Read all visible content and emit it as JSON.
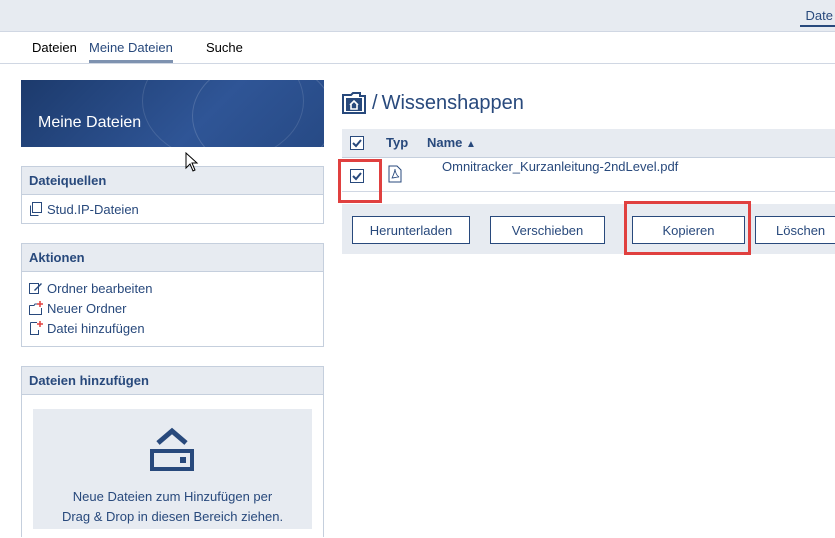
{
  "topbar": {
    "link_label": "Date"
  },
  "nav": {
    "tabs": [
      "Dateien",
      "Meine Dateien",
      "Suche"
    ]
  },
  "sidebar": {
    "header_title": "Meine Dateien",
    "sources": {
      "title": "Dateiquellen",
      "items": [
        "Stud.IP-Dateien"
      ]
    },
    "actions": {
      "title": "Aktionen",
      "items": [
        "Ordner bearbeiten",
        "Neuer Ordner",
        "Datei hinzufügen"
      ]
    },
    "upload": {
      "title": "Dateien hinzufügen",
      "drop_text_1": "Neue Dateien zum Hinzufügen per",
      "drop_text_2": "Drag & Drop in diesen Bereich ziehen."
    }
  },
  "main": {
    "breadcrumb_sep": "/",
    "folder_name": "Wissenshappen",
    "table": {
      "col_type": "Typ",
      "col_name": "Name",
      "sort_indicator": "▲",
      "rows": [
        {
          "name": "Omnitracker_Kurzanleitung-2ndLevel.pdf",
          "checked": true,
          "icon": "pdf-file-icon"
        }
      ]
    },
    "buttons": {
      "download": "Herunterladen",
      "move": "Verschieben",
      "copy": "Kopieren",
      "delete": "Löschen"
    }
  },
  "colors": {
    "primary": "#28497c",
    "highlight": "#e0403f",
    "panel": "#e7ebf1"
  }
}
